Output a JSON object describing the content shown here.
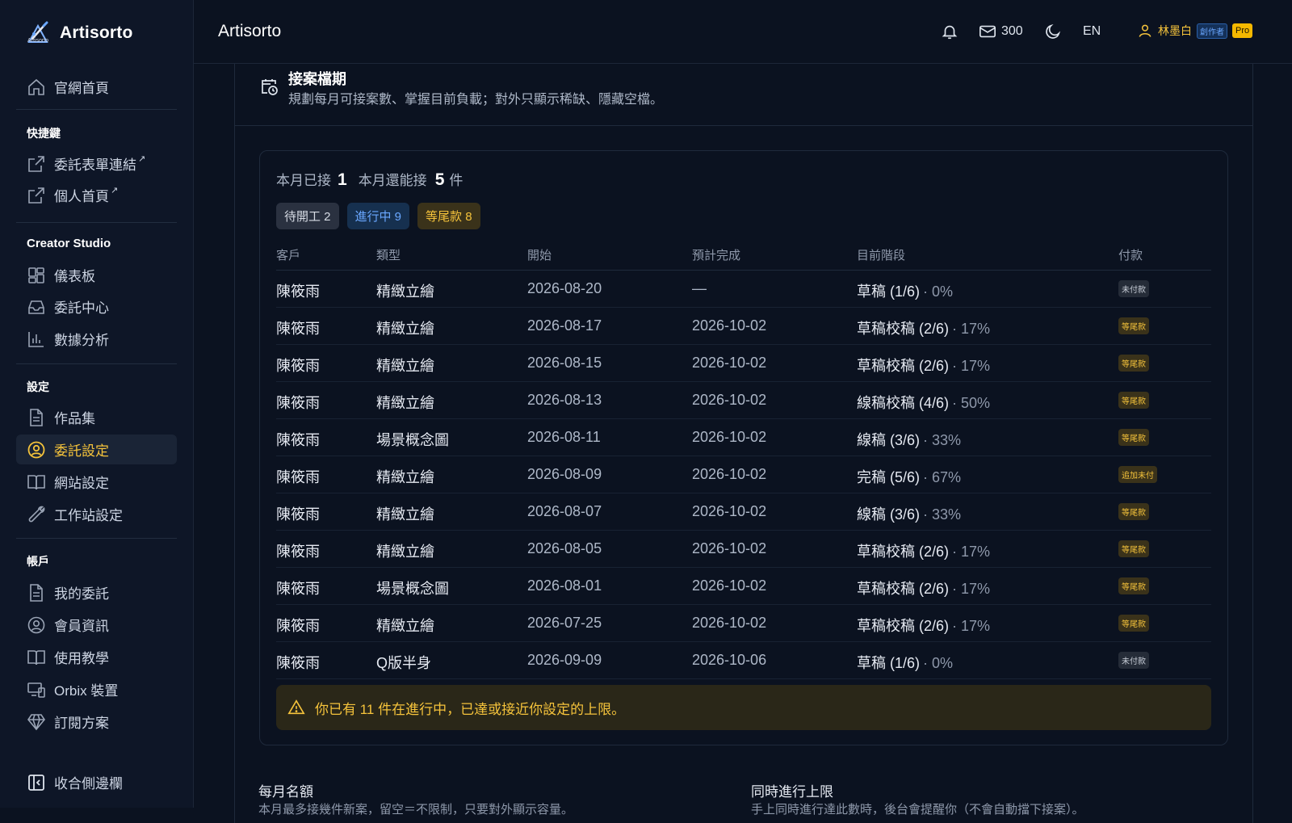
{
  "brand": {
    "name": "Artisorto",
    "sub": "Artisorto"
  },
  "sidebar": {
    "home": "官網首頁",
    "shortcuts_title": "快捷鍵",
    "shortcuts": [
      "委託表單連結",
      "個人首頁"
    ],
    "external_mark": "↗",
    "studio_title": "Creator Studio",
    "studio": [
      "儀表板",
      "委託中心",
      "數據分析"
    ],
    "settings_title": "設定",
    "settings": [
      "作品集",
      "委託設定",
      "網站設定",
      "工作站設定"
    ],
    "account_title": "帳戶",
    "account": [
      "我的委託",
      "會員資訊",
      "使用教學",
      "Orbix 裝置",
      "訂閱方案"
    ],
    "collapse": "收合側邊欄"
  },
  "topbar": {
    "title": "Artisorto",
    "mail_count": "300",
    "lang": "EN",
    "user_name": "林墨白",
    "creator_badge": "創作者",
    "pro_badge": "Pro"
  },
  "panel": {
    "title": "接案檔期",
    "desc": "規劃每月可接案數、掌握目前負載；對外只顯示稀缺、隱藏空檔。"
  },
  "stats": {
    "accepted_label": "本月已接",
    "accepted_value": "1",
    "remaining_label": "本月還能接",
    "remaining_value": "5",
    "unit": "件"
  },
  "chips": {
    "pending": "待開工 2",
    "in_progress": "進行中 9",
    "awaiting_final": "等尾款 8"
  },
  "table": {
    "headers": [
      "客戶",
      "類型",
      "開始",
      "預計完成",
      "目前階段",
      "付款"
    ],
    "rows": [
      {
        "client": "陳筱雨",
        "type": "精緻立繪",
        "start": "2026-08-20",
        "due": "—",
        "stage": "草稿 (1/6)",
        "pct": "· 0%",
        "pay": "未付款",
        "pay_kind": "unpaid"
      },
      {
        "client": "陳筱雨",
        "type": "精緻立繪",
        "start": "2026-08-17",
        "due": "2026-10-02",
        "stage": "草稿校稿 (2/6)",
        "pct": "· 17%",
        "pay": "等尾款",
        "pay_kind": "due"
      },
      {
        "client": "陳筱雨",
        "type": "精緻立繪",
        "start": "2026-08-15",
        "due": "2026-10-02",
        "stage": "草稿校稿 (2/6)",
        "pct": "· 17%",
        "pay": "等尾款",
        "pay_kind": "due"
      },
      {
        "client": "陳筱雨",
        "type": "精緻立繪",
        "start": "2026-08-13",
        "due": "2026-10-02",
        "stage": "線稿校稿 (4/6)",
        "pct": "· 50%",
        "pay": "等尾款",
        "pay_kind": "due"
      },
      {
        "client": "陳筱雨",
        "type": "場景概念圖",
        "start": "2026-08-11",
        "due": "2026-10-02",
        "stage": "線稿 (3/6)",
        "pct": "· 33%",
        "pay": "等尾款",
        "pay_kind": "due"
      },
      {
        "client": "陳筱雨",
        "type": "精緻立繪",
        "start": "2026-08-09",
        "due": "2026-10-02",
        "stage": "完稿 (5/6)",
        "pct": "· 67%",
        "pay": "追加未付",
        "pay_kind": "due"
      },
      {
        "client": "陳筱雨",
        "type": "精緻立繪",
        "start": "2026-08-07",
        "due": "2026-10-02",
        "stage": "線稿 (3/6)",
        "pct": "· 33%",
        "pay": "等尾款",
        "pay_kind": "due"
      },
      {
        "client": "陳筱雨",
        "type": "精緻立繪",
        "start": "2026-08-05",
        "due": "2026-10-02",
        "stage": "草稿校稿 (2/6)",
        "pct": "· 17%",
        "pay": "等尾款",
        "pay_kind": "due"
      },
      {
        "client": "陳筱雨",
        "type": "場景概念圖",
        "start": "2026-08-01",
        "due": "2026-10-02",
        "stage": "草稿校稿 (2/6)",
        "pct": "· 17%",
        "pay": "等尾款",
        "pay_kind": "due"
      },
      {
        "client": "陳筱雨",
        "type": "精緻立繪",
        "start": "2026-07-25",
        "due": "2026-10-02",
        "stage": "草稿校稿 (2/6)",
        "pct": "· 17%",
        "pay": "等尾款",
        "pay_kind": "due"
      },
      {
        "client": "陳筱雨",
        "type": "Q版半身",
        "start": "2026-09-09",
        "due": "2026-10-06",
        "stage": "草稿 (1/6)",
        "pct": "· 0%",
        "pay": "未付款",
        "pay_kind": "unpaid"
      }
    ]
  },
  "warning": {
    "text": "你已有 11 件在進行中，已達或接近你設定的上限。"
  },
  "bottom": {
    "left_title": "每月名額",
    "left_desc": "本月最多接幾件新案，留空＝不限制，只要對外顯示容量。",
    "right_title": "同時進行上限",
    "right_desc": "手上同時進行達此數時，後台會提醒你（不會自動擋下接案）。"
  },
  "colors": {
    "bg": "#0b1220",
    "sidebar": "#0e1627",
    "accent": "#f5c33b",
    "blue": "#6aa7ff"
  }
}
